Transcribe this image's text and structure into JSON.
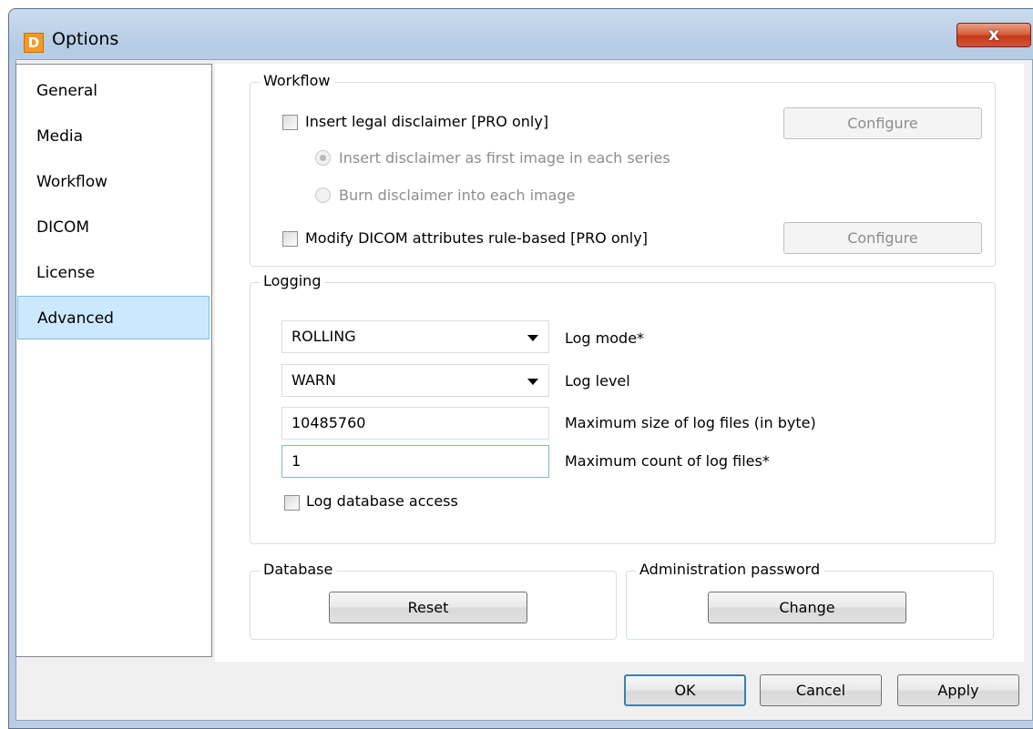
{
  "window": {
    "title": "Options",
    "app_icon_letter": "D",
    "close_glyph": "x"
  },
  "sidebar": {
    "items": [
      {
        "label": "General"
      },
      {
        "label": "Media"
      },
      {
        "label": "Workflow"
      },
      {
        "label": "DICOM"
      },
      {
        "label": "License"
      },
      {
        "label": "Advanced",
        "selected": true
      }
    ]
  },
  "workflow": {
    "legend": "Workflow",
    "insert_disclaimer": {
      "label": "Insert legal disclaimer [PRO only]",
      "checked": false
    },
    "configure_label_1": "Configure",
    "radio_first_image": {
      "label": "Insert disclaimer as first image in each series",
      "checked": true
    },
    "radio_burn": {
      "label": "Burn disclaimer into each image",
      "checked": false
    },
    "modify_dicom": {
      "label": "Modify DICOM attributes rule-based [PRO only]",
      "checked": false
    },
    "configure_label_2": "Configure"
  },
  "logging": {
    "legend": "Logging",
    "log_mode": {
      "value": "ROLLING",
      "label": "Log mode*"
    },
    "log_level": {
      "value": "WARN",
      "label": "Log level"
    },
    "max_size": {
      "value": "10485760",
      "label": "Maximum size of log files (in byte)"
    },
    "max_count": {
      "value": "1",
      "label": "Maximum count of log files*"
    },
    "db_access": {
      "label": "Log database access",
      "checked": false
    }
  },
  "database": {
    "legend": "Database",
    "reset_label": "Reset"
  },
  "admin_password": {
    "legend": "Administration password",
    "change_label": "Change"
  },
  "footer": {
    "ok_label": "OK",
    "cancel_label": "Cancel",
    "apply_label": "Apply"
  }
}
